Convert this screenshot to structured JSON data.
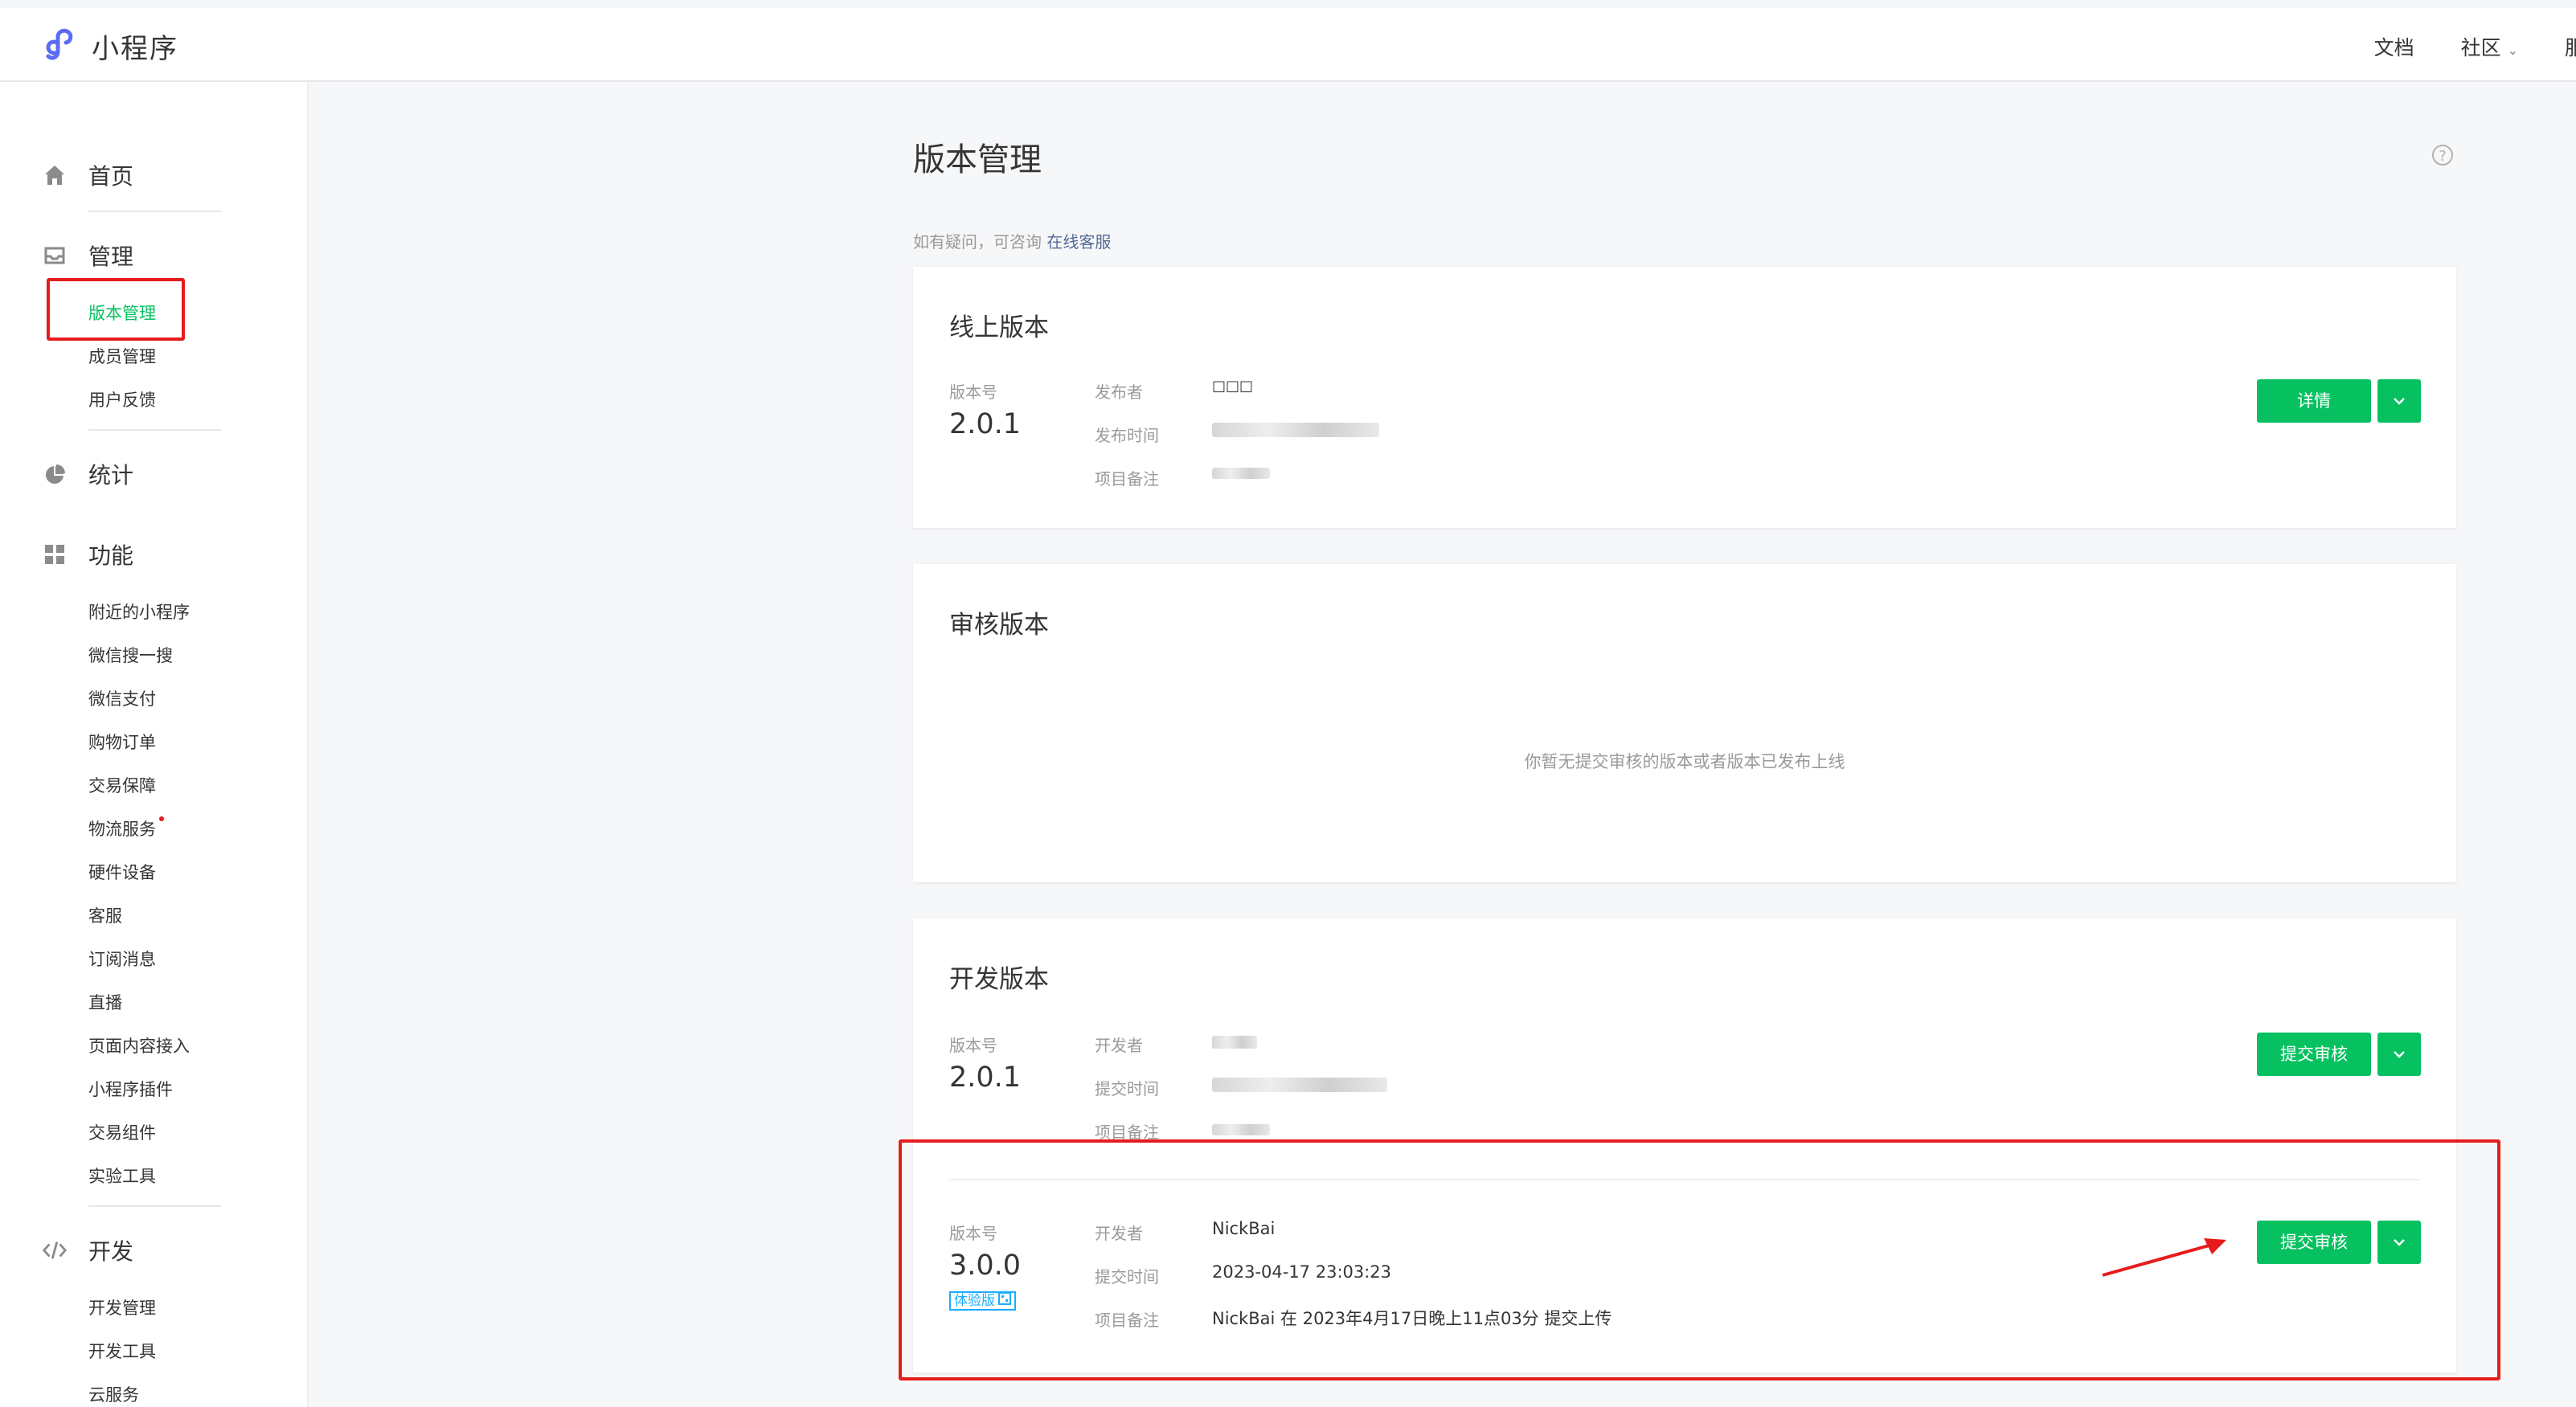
{
  "header": {
    "logo_text": "小程序",
    "nav": [
      "文档",
      "社区",
      "服"
    ],
    "community_chevron": "chevron-down-icon"
  },
  "sidebar": {
    "sections": [
      {
        "label": "首页",
        "icon": "home-icon"
      },
      {
        "label": "管理",
        "icon": "inbox-icon",
        "items": [
          "版本管理",
          "成员管理",
          "用户反馈"
        ]
      },
      {
        "label": "统计",
        "icon": "pie-chart-icon"
      },
      {
        "label": "功能",
        "icon": "grid-icon",
        "items": [
          "附近的小程序",
          "微信搜一搜",
          "微信支付",
          "购物订单",
          "交易保障",
          "物流服务",
          "硬件设备",
          "客服",
          "订阅消息",
          "直播",
          "页面内容接入",
          "小程序插件",
          "交易组件",
          "实验工具"
        ]
      },
      {
        "label": "开发",
        "icon": "code-icon",
        "items": [
          "开发管理",
          "开发工具",
          "云服务"
        ]
      }
    ],
    "active_item": "版本管理"
  },
  "main": {
    "title": "版本管理",
    "hint_prefix": "如有疑问，可咨询",
    "hint_link": "在线客服",
    "online": {
      "title": "线上版本",
      "version_label": "版本号",
      "version": "2.0.1",
      "publisher_label": "发布者",
      "publisher": "□□□",
      "publish_time_label": "发布时间",
      "remark_label": "项目备注",
      "detail_button": "详情"
    },
    "review": {
      "title": "审核版本",
      "empty_text": "你暂无提交审核的版本或者版本已发布上线"
    },
    "dev": {
      "title": "开发版本",
      "rows": [
        {
          "version_label": "版本号",
          "version": "2.0.1",
          "developer_label": "开发者",
          "developer": "",
          "submit_time_label": "提交时间",
          "submit_time": "",
          "remark_label": "项目备注",
          "remark": "",
          "submit_button": "提交审核"
        },
        {
          "version_label": "版本号",
          "version": "3.0.0",
          "badge": "体验版",
          "developer_label": "开发者",
          "developer": "NickBai",
          "submit_time_label": "提交时间",
          "submit_time": "2023-04-17 23:03:23",
          "remark_label": "项目备注",
          "remark": "NickBai 在 2023年4月17日晚上11点03分 提交上传",
          "submit_button": "提交审核"
        }
      ]
    }
  },
  "colors": {
    "accent_green": "#07c160",
    "annotation_red": "#e61c1c",
    "link_blue": "#576b95",
    "badge_blue": "#1aadff"
  }
}
